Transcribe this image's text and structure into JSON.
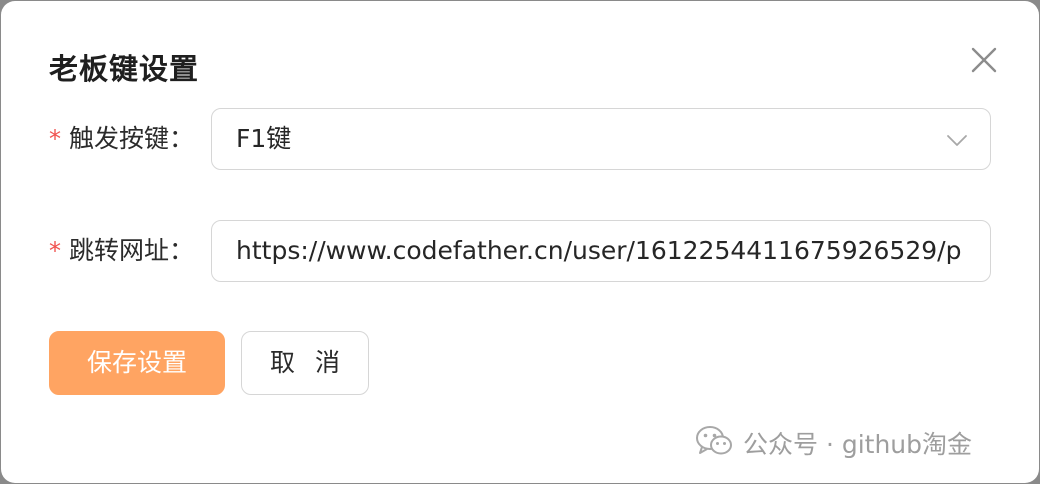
{
  "dialog": {
    "title": "老板键设置",
    "close_icon": "close-icon"
  },
  "form": {
    "trigger_key": {
      "required_mark": "*",
      "label": "触发按键：",
      "value": "F1键",
      "icon": "chevron-down-icon"
    },
    "redirect_url": {
      "required_mark": "*",
      "label": "跳转网址：",
      "value": "https://www.codefather.cn/user/1612254411675926529/p"
    }
  },
  "actions": {
    "save_label": "保存设置",
    "cancel_label": "取 消"
  },
  "watermark": {
    "text": "公众号 · github淘金",
    "icon": "wechat-icon"
  },
  "colors": {
    "accent": "#ffa462",
    "required": "#f0524f",
    "border": "#d6d6d6"
  }
}
